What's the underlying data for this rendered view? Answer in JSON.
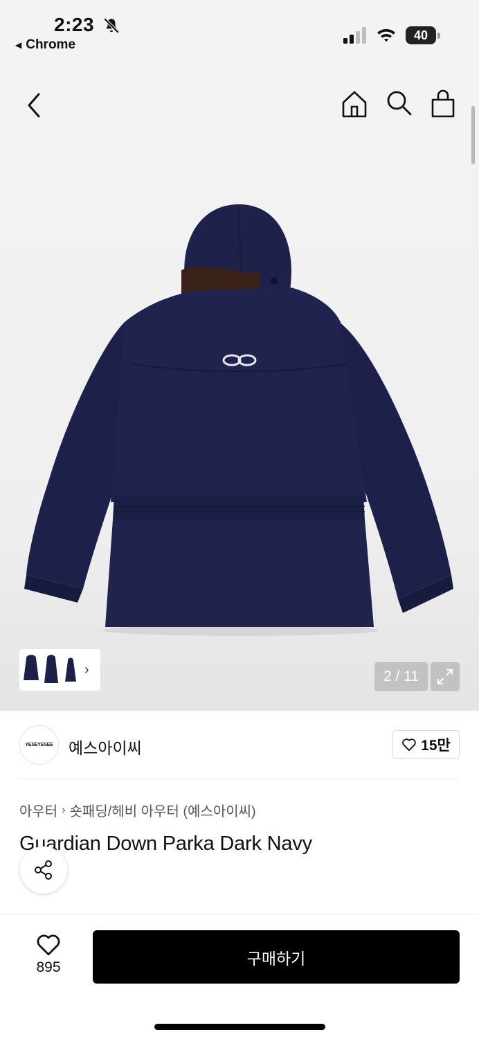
{
  "status_bar": {
    "time": "2:23",
    "back_app": "Chrome",
    "battery": "40",
    "icons": [
      "bell-slash-icon",
      "signal-icon",
      "wifi-icon",
      "battery-icon"
    ]
  },
  "header": {
    "icons": [
      "chevron-left-icon",
      "home-icon",
      "search-icon",
      "shopping-bag-icon"
    ]
  },
  "gallery": {
    "pager": "2 / 11",
    "icons": [
      "chevron-right-icon",
      "expand-icon"
    ]
  },
  "brand": {
    "logo_text": "YESEYESEE",
    "name": "예스아이씨",
    "likes": "15만"
  },
  "product": {
    "breadcrumb": [
      "아우터",
      "숏패딩/헤비 아우터 (예스아이씨)"
    ],
    "title": "Guardian Down Parka Dark Navy"
  },
  "bottom_bar": {
    "wish_count": "895",
    "buy_label": "구매하기"
  },
  "colors": {
    "jacket": "#1c2148",
    "fur": "#3a2218",
    "buy_button": "#000000",
    "gallery_bg": "#f3f3f3"
  }
}
